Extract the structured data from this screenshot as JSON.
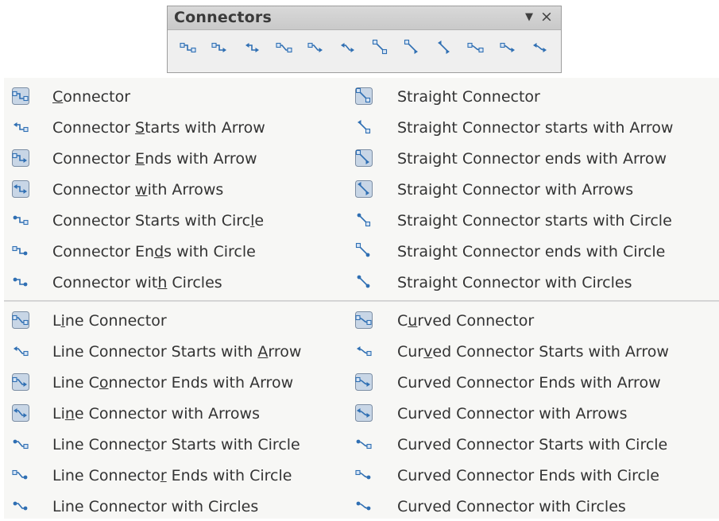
{
  "toolbar": {
    "title": "Connectors",
    "menu_glyph": "▼",
    "close_glyph": "×",
    "buttons": [
      {
        "icon": "connector-icon",
        "style": "elbow",
        "start": "none",
        "end": "none"
      },
      {
        "icon": "connector-ends-arrow-icon",
        "style": "elbow",
        "start": "none",
        "end": "arrow"
      },
      {
        "icon": "connector-arrows-icon",
        "style": "elbow",
        "start": "arrow",
        "end": "arrow"
      },
      {
        "icon": "line-connector-icon",
        "style": "line",
        "start": "none",
        "end": "none"
      },
      {
        "icon": "line-connector-ends-arrow-icon",
        "style": "line",
        "start": "none",
        "end": "arrow"
      },
      {
        "icon": "line-connector-arrows-icon",
        "style": "line",
        "start": "arrow",
        "end": "arrow"
      },
      {
        "icon": "straight-connector-icon",
        "style": "straight",
        "start": "none",
        "end": "none"
      },
      {
        "icon": "straight-connector-ends-arrow-icon",
        "style": "straight",
        "start": "none",
        "end": "arrow"
      },
      {
        "icon": "straight-connector-arrows-icon",
        "style": "straight",
        "start": "arrow",
        "end": "arrow"
      },
      {
        "icon": "curved-connector-icon",
        "style": "curved",
        "start": "none",
        "end": "none"
      },
      {
        "icon": "curved-connector-ends-arrow-icon",
        "style": "curved",
        "start": "none",
        "end": "arrow"
      },
      {
        "icon": "curved-connector-arrows-icon",
        "style": "curved",
        "start": "arrow",
        "end": "arrow"
      }
    ]
  },
  "menu": {
    "left_top": [
      {
        "label": "Connector",
        "mnemonic": "C",
        "icon": "connector-icon",
        "style": "elbow",
        "start": "none",
        "end": "none",
        "framed": true
      },
      {
        "label": "Connector Starts with Arrow",
        "mnemonic": "S",
        "icon": "connector-starts-arrow-icon",
        "style": "elbow",
        "start": "arrow",
        "end": "none",
        "framed": false
      },
      {
        "label": "Connector Ends with Arrow",
        "mnemonic": "E",
        "icon": "connector-ends-arrow-icon",
        "style": "elbow",
        "start": "none",
        "end": "arrow",
        "framed": true
      },
      {
        "label": "Connector with Arrows",
        "mnemonic": "w",
        "icon": "connector-arrows-icon",
        "style": "elbow",
        "start": "arrow",
        "end": "arrow",
        "framed": true
      },
      {
        "label": "Connector Starts with Circle",
        "mnemonic": "l",
        "icon": "connector-starts-circle-icon",
        "style": "elbow",
        "start": "circle",
        "end": "none",
        "framed": false
      },
      {
        "label": "Connector Ends with Circle",
        "mnemonic": "d",
        "icon": "connector-ends-circle-icon",
        "style": "elbow",
        "start": "none",
        "end": "circle",
        "framed": false
      },
      {
        "label": "Connector with Circles",
        "mnemonic": "h",
        "icon": "connector-circles-icon",
        "style": "elbow",
        "start": "circle",
        "end": "circle",
        "framed": false
      }
    ],
    "left_bottom": [
      {
        "label": "Line Connector",
        "mnemonic": "i",
        "icon": "line-connector-icon",
        "style": "line",
        "start": "none",
        "end": "none",
        "framed": true
      },
      {
        "label": "Line Connector Starts with Arrow",
        "mnemonic": "A",
        "icon": "line-connector-starts-arrow-icon",
        "style": "line",
        "start": "arrow",
        "end": "none",
        "framed": false
      },
      {
        "label": "Line Connector Ends with Arrow",
        "mnemonic": "o",
        "icon": "line-connector-ends-arrow-icon",
        "style": "line",
        "start": "none",
        "end": "arrow",
        "framed": true
      },
      {
        "label": "Line Connector with Arrows",
        "mnemonic": "n",
        "icon": "line-connector-arrows-icon",
        "style": "line",
        "start": "arrow",
        "end": "arrow",
        "framed": true
      },
      {
        "label": "Line Connector Starts with Circle",
        "mnemonic": "t",
        "icon": "line-connector-starts-circle-icon",
        "style": "line",
        "start": "circle",
        "end": "none",
        "framed": false
      },
      {
        "label": "Line Connector Ends with Circle",
        "mnemonic": "r",
        "icon": "line-connector-ends-circle-icon",
        "style": "line",
        "start": "none",
        "end": "circle",
        "framed": false
      },
      {
        "label": "Line Connector with Circles",
        "mnemonic": "",
        "icon": "line-connector-circles-icon",
        "style": "line",
        "start": "circle",
        "end": "circle",
        "framed": false
      }
    ],
    "right_top": [
      {
        "label": "Straight Connector",
        "mnemonic": "g",
        "icon": "straight-connector-icon",
        "style": "straight",
        "start": "none",
        "end": "none",
        "framed": true
      },
      {
        "label": "Straight Connector starts with Arrow",
        "mnemonic": "",
        "icon": "straight-connector-starts-arrow-icon",
        "style": "straight",
        "start": "arrow",
        "end": "none",
        "framed": false
      },
      {
        "label": "Straight Connector ends with Arrow",
        "mnemonic": "",
        "icon": "straight-connector-ends-arrow-icon",
        "style": "straight",
        "start": "none",
        "end": "arrow",
        "framed": true
      },
      {
        "label": "Straight Connector with Arrows",
        "mnemonic": "",
        "icon": "straight-connector-arrows-icon",
        "style": "straight",
        "start": "arrow",
        "end": "arrow",
        "framed": true
      },
      {
        "label": "Straight Connector starts with Circle",
        "mnemonic": "",
        "icon": "straight-connector-starts-circle-icon",
        "style": "straight",
        "start": "circle",
        "end": "none",
        "framed": false
      },
      {
        "label": "Straight Connector ends with Circle",
        "mnemonic": "",
        "icon": "straight-connector-ends-circle-icon",
        "style": "straight",
        "start": "none",
        "end": "circle",
        "framed": false
      },
      {
        "label": "Straight Connector with Circles",
        "mnemonic": "",
        "icon": "straight-connector-circles-icon",
        "style": "straight",
        "start": "circle",
        "end": "circle",
        "framed": false
      }
    ],
    "right_bottom": [
      {
        "label": "Curved Connector",
        "mnemonic": "u",
        "icon": "curved-connector-icon",
        "style": "curved",
        "start": "none",
        "end": "none",
        "framed": true
      },
      {
        "label": "Curved Connector Starts with Arrow",
        "mnemonic": "v",
        "icon": "curved-connector-starts-arrow-icon",
        "style": "curved",
        "start": "arrow",
        "end": "none",
        "framed": false
      },
      {
        "label": "Curved Connector Ends with Arrow",
        "mnemonic": "",
        "icon": "curved-connector-ends-arrow-icon",
        "style": "curved",
        "start": "none",
        "end": "arrow",
        "framed": true
      },
      {
        "label": "Curved Connector with Arrows",
        "mnemonic": "",
        "icon": "curved-connector-arrows-icon",
        "style": "curved",
        "start": "arrow",
        "end": "arrow",
        "framed": true
      },
      {
        "label": "Curved Connector Starts with Circle",
        "mnemonic": "",
        "icon": "curved-connector-starts-circle-icon",
        "style": "curved",
        "start": "circle",
        "end": "none",
        "framed": false
      },
      {
        "label": "Curved Connector Ends with Circle",
        "mnemonic": "",
        "icon": "curved-connector-ends-circle-icon",
        "style": "curved",
        "start": "none",
        "end": "circle",
        "framed": false
      },
      {
        "label": "Curved Connector with Circles",
        "mnemonic": "",
        "icon": "curved-connector-circles-icon",
        "style": "curved",
        "start": "circle",
        "end": "circle",
        "framed": false
      }
    ]
  },
  "colors": {
    "icon_blue": "#2f6fb3",
    "icon_box_fill": "#d9e6f5",
    "frame_fill": "#c8d6e6",
    "frame_border": "#7c8ea4"
  }
}
